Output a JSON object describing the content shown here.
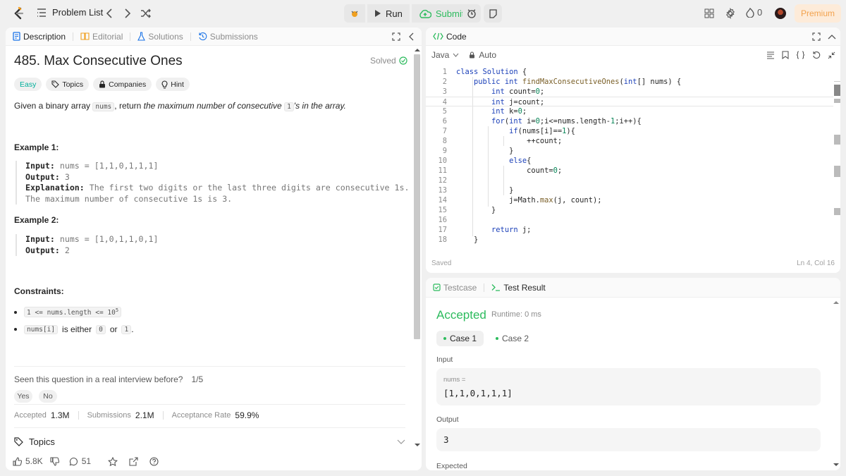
{
  "nav": {
    "problem_list": "Problem List",
    "run": "Run",
    "submit": "Submit",
    "streak": "0",
    "premium": "Premium"
  },
  "tabs": [
    {
      "label": "Description",
      "icon": "document-icon"
    },
    {
      "label": "Editorial",
      "icon": "book-icon"
    },
    {
      "label": "Solutions",
      "icon": "flask-icon"
    },
    {
      "label": "Submissions",
      "icon": "history-icon"
    }
  ],
  "problem": {
    "title": "485. Max Consecutive Ones",
    "status": "Solved",
    "tags": [
      "Easy",
      "Topics",
      "Companies",
      "Hint"
    ],
    "desc_a": "Given a binary array ",
    "desc_code": "nums",
    "desc_b": ", return ",
    "desc_em": "the maximum number of consecutive ",
    "desc_code2": "1",
    "desc_em2": "'s in the array."
  },
  "examples": [
    {
      "heading": "Example 1:",
      "input_k": "Input:",
      "input_v": " nums = [1,1,0,1,1,1]",
      "output_k": "Output:",
      "output_v": " 3",
      "expl_k": "Explanation:",
      "expl_v": " The first two digits or the last three digits are consecutive 1s.",
      "expl_v2": "The maximum number of consecutive 1s is 3."
    },
    {
      "heading": "Example 2:",
      "input_k": "Input:",
      "input_v": " nums = [1,0,1,1,0,1]",
      "output_k": "Output:",
      "output_v": " 2"
    }
  ],
  "constraints": {
    "heading": "Constraints:",
    "c1": "1 <= nums.length <= 10",
    "c1_sup": "5",
    "c2_code": "nums[i]",
    "c2_mid": " is either ",
    "c2_a": "0",
    "c2_or": " or ",
    "c2_b": "1",
    "c2_end": "."
  },
  "interview": {
    "question": "Seen this question in a real interview before?",
    "count": "1/5",
    "yes": "Yes",
    "no": "No"
  },
  "stats": {
    "accepted_label": "Accepted",
    "accepted": "1.3M",
    "submissions_label": "Submissions",
    "submissions": "2.1M",
    "rate_label": "Acceptance Rate",
    "rate": "59.9%"
  },
  "topics_label": "Topics",
  "bottom": {
    "likes": "5.8K",
    "comments": "51"
  },
  "code": {
    "title": "Code",
    "language": "Java",
    "mode": "Auto",
    "saved": "Saved",
    "cursor": "Ln 4, Col 16",
    "lines": [
      "class Solution {",
      "    public int findMaxConsecutiveOnes(int[] nums) {",
      "        int count=0;",
      "        int j=count;",
      "        int k=0;",
      "        for(int i=0;i<=nums.length-1;i++){",
      "            if(nums[i]==1){",
      "                ++count;",
      "            }",
      "            else{",
      "                count=0;",
      "",
      "            }",
      "            j=Math.max(j, count);",
      "        }",
      "",
      "        return j;",
      "    }"
    ]
  },
  "test": {
    "tab_testcase": "Testcase",
    "tab_result": "Test Result",
    "verdict": "Accepted",
    "runtime": "Runtime: 0 ms",
    "case1": "Case 1",
    "case2": "Case 2",
    "input_label": "Input",
    "input_var": "nums =",
    "input_val": "[1,1,0,1,1,1]",
    "output_label": "Output",
    "output_val": "3",
    "expected_label": "Expected"
  }
}
